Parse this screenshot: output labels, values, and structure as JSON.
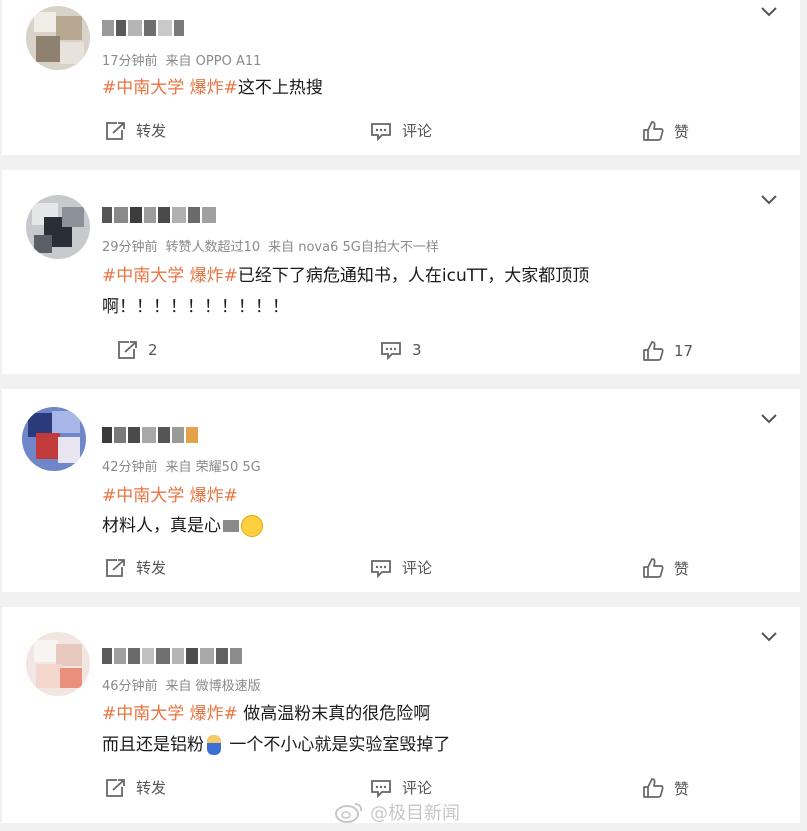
{
  "posts": [
    {
      "meta": [
        "17分钟前",
        "来自 OPPO A11"
      ],
      "tag": "#中南大学 爆炸#",
      "line1_rest": "这不上热搜",
      "line2": "",
      "repost": "转发",
      "comment": "评论",
      "like": "赞"
    },
    {
      "meta": [
        "29分钟前",
        "转赞人数超过10",
        "来自 nova6 5G自拍大不一样"
      ],
      "tag": "#中南大学 爆炸#",
      "line1_rest": "已经下了病危通知书，人在icuTT，大家都顶顶",
      "line2": "啊！！！！！！！！！！",
      "repost": "2",
      "comment": "3",
      "like": "17"
    },
    {
      "meta": [
        "42分钟前",
        "来自 荣耀50 5G"
      ],
      "tag": "#中南大学 爆炸#",
      "line1_rest": "",
      "line2": "材料人，真是心",
      "repost": "转发",
      "comment": "评论",
      "like": "赞"
    },
    {
      "meta": [
        "46分钟前",
        "来自 微博极速版"
      ],
      "tag": "#中南大学 爆炸#",
      "line1_rest": " 做高温粉末真的很危险啊",
      "line2": "而且还是铝粉",
      "line2_after": " 一个不小心就是实验室毁掉了",
      "repost": "转发",
      "comment": "评论",
      "like": "赞"
    }
  ],
  "watermark": "@极目新闻",
  "colors": {
    "tag": "#eb7340",
    "text": "#1a1a1a",
    "meta": "#8a8a8a",
    "bg": "#f1f1f1"
  },
  "icons": [
    "chevron-down-icon",
    "repost-icon",
    "comment-icon",
    "like-icon",
    "weibo-logo-icon"
  ]
}
